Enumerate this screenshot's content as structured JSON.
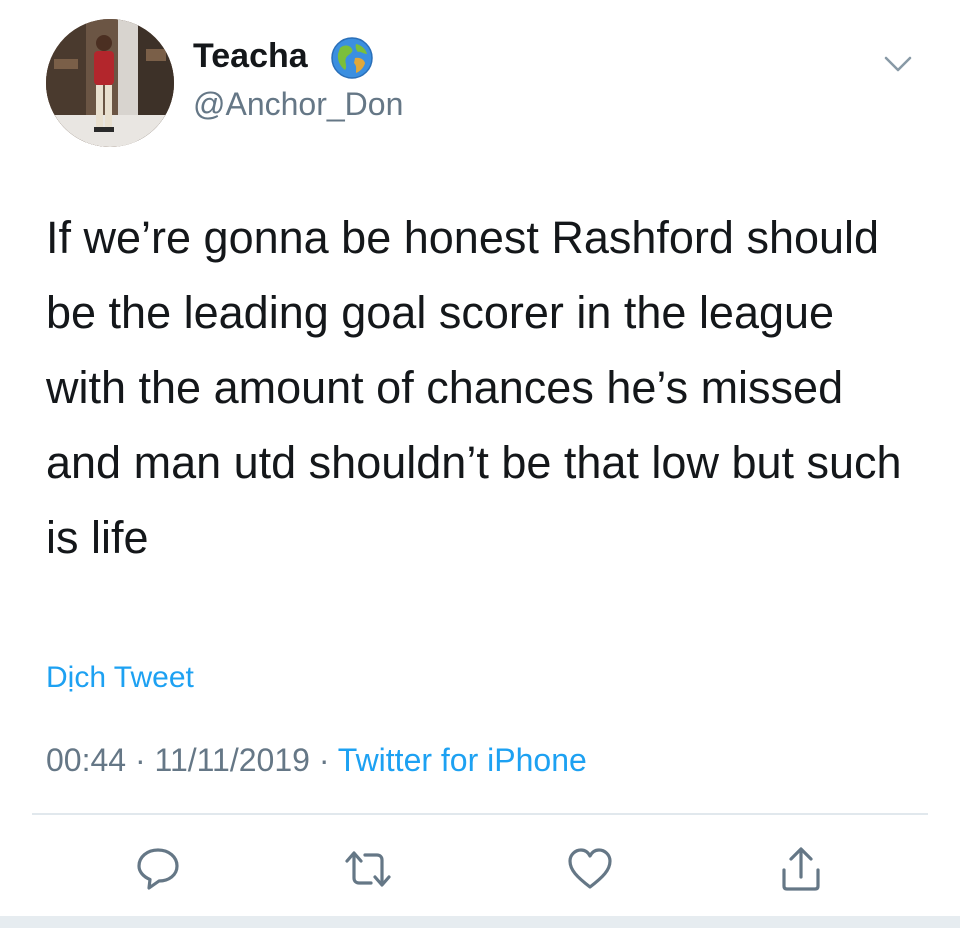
{
  "tweet": {
    "display_name": "Teacha",
    "name_emoji_icon": "globe-icon",
    "handle": "@Anchor_Don",
    "text": "If we’re gonna be honest Rashford should be the leading goal scorer in the league with the amount of chances he’s missed and man utd shouldn’t be that low but such is life",
    "translate_label": "Dịch Tweet",
    "time": "00:44",
    "date": "11/11/2019",
    "separator": " · ",
    "source": "Twitter for iPhone"
  },
  "actions": [
    {
      "name": "reply",
      "icon": "reply-icon"
    },
    {
      "name": "retweet",
      "icon": "retweet-icon"
    },
    {
      "name": "like",
      "icon": "heart-icon"
    },
    {
      "name": "share",
      "icon": "share-icon"
    }
  ],
  "colors": {
    "text": "#14171a",
    "secondary": "#657786",
    "accent": "#1da1f2",
    "divider": "#e1e8ed",
    "background": "#ffffff"
  }
}
